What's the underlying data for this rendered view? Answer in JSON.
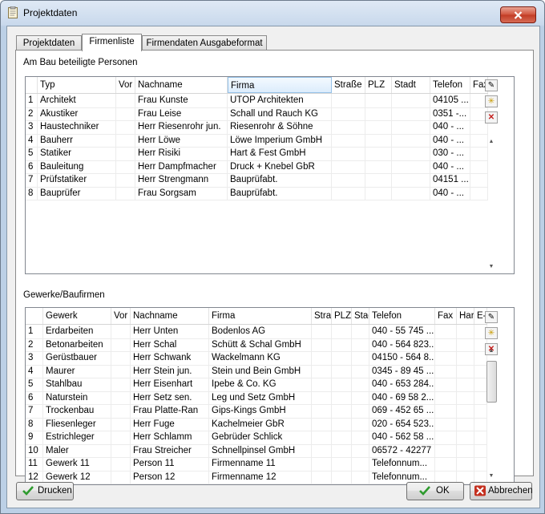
{
  "window": {
    "title": "Projektdaten"
  },
  "tabs": [
    {
      "label": "Projektdaten"
    },
    {
      "label": "Firmenliste"
    },
    {
      "label": "Firmendaten Ausgabeformat"
    }
  ],
  "persons": {
    "label": "Am Bau beteiligte Personen",
    "columns": [
      "",
      "Typ",
      "Vor",
      "Nachname",
      "Firma",
      "Straße",
      "PLZ",
      "Stadt",
      "Telefon",
      "Fax"
    ],
    "rows": [
      [
        "1",
        "Architekt",
        "",
        "Frau Kunste",
        "UTOP Architekten",
        "",
        "",
        "",
        "04105 ...",
        ""
      ],
      [
        "2",
        "Akustiker",
        "",
        "Frau Leise",
        "Schall und Rauch KG",
        "",
        "",
        "",
        "0351 -...",
        ""
      ],
      [
        "3",
        "Haustechniker",
        "",
        "Herr Riesenrohr jun.",
        "Riesenrohr & Söhne",
        "",
        "",
        "",
        "040 - ...",
        ""
      ],
      [
        "4",
        "Bauherr",
        "",
        "Herr Löwe",
        "Löwe Imperium GmbH",
        "",
        "",
        "",
        "040 - ...",
        ""
      ],
      [
        "5",
        "Statiker",
        "",
        "Herr Risiki",
        "Hart & Fest GmbH",
        "",
        "",
        "",
        "030 - ...",
        ""
      ],
      [
        "6",
        "Bauleitung",
        "",
        "Herr Dampfmacher",
        "Druck + Knebel GbR",
        "",
        "",
        "",
        "040 - ...",
        ""
      ],
      [
        "7",
        "Prüfstatiker",
        "",
        "Herr Strengmann",
        "Bauprüfabt.",
        "",
        "",
        "",
        "04151 ...",
        ""
      ],
      [
        "8",
        "Bauprüfer",
        "",
        "Frau Sorgsam",
        "Bauprüfabt.",
        "",
        "",
        "",
        "040 - ...",
        ""
      ]
    ]
  },
  "companies": {
    "label": "Gewerke/Baufirmen",
    "columns": [
      "",
      "Gewerk",
      "Vor",
      "Nachname",
      "Firma",
      "Stra",
      "PLZ",
      "Stac",
      "Telefon",
      "Fax",
      "Har",
      "E-"
    ],
    "rows": [
      [
        "1",
        "Erdarbeiten",
        "",
        "Herr Unten",
        "Bodenlos AG",
        "",
        "",
        "",
        "040 - 55 745 ...",
        "",
        "",
        ""
      ],
      [
        "2",
        "Betonarbeiten",
        "",
        "Herr Schal",
        "Schütt & Schal GmbH",
        "",
        "",
        "",
        "040 - 564 823...",
        "",
        "",
        ""
      ],
      [
        "3",
        "Gerüstbauer",
        "",
        "Herr Schwank",
        "Wackelmann KG",
        "",
        "",
        "",
        "04150 - 564 8...",
        "",
        "",
        ""
      ],
      [
        "4",
        "Maurer",
        "",
        "Herr Stein jun.",
        "Stein und Bein GmbH",
        "",
        "",
        "",
        "0345 - 89 45 ...",
        "",
        "",
        ""
      ],
      [
        "5",
        "Stahlbau",
        "",
        "Herr Eisenhart",
        "Ipebe & Co. KG",
        "",
        "",
        "",
        "040 - 653 284...",
        "",
        "",
        ""
      ],
      [
        "6",
        "Naturstein",
        "",
        "Herr Setz sen.",
        "Leg und Setz GmbH",
        "",
        "",
        "",
        "040 - 69 58 2...",
        "",
        "",
        ""
      ],
      [
        "7",
        "Trockenbau",
        "",
        "Frau Platte-Ran",
        "Gips-Kings GmbH",
        "",
        "",
        "",
        "069 - 452 65 ...",
        "",
        "",
        ""
      ],
      [
        "8",
        "Fliesenleger",
        "",
        "Herr Fuge",
        "Kachelmeier GbR",
        "",
        "",
        "",
        "020 - 654 523...",
        "",
        "",
        ""
      ],
      [
        "9",
        "Estrichleger",
        "",
        "Herr Schlamm",
        "Gebrüder Schlick",
        "",
        "",
        "",
        "040 - 562 58 ...",
        "",
        "",
        ""
      ],
      [
        "10",
        "Maler",
        "",
        "Frau Streicher",
        "Schnellpinsel GmbH",
        "",
        "",
        "",
        "06572 - 42277",
        "",
        "",
        ""
      ],
      [
        "11",
        "Gewerk 11",
        "",
        "Person 11",
        "Firmenname 11",
        "",
        "",
        "",
        "Telefonnum...",
        "",
        "",
        ""
      ],
      [
        "12",
        "Gewerk 12",
        "",
        "Person 12",
        "Firmenname 12",
        "",
        "",
        "",
        "Telefonnum...",
        "",
        "",
        ""
      ]
    ]
  },
  "buttons": {
    "print": "Drucken",
    "ok": "OK",
    "cancel": "Abbrechen"
  },
  "icons": {
    "window": "clipboard-icon",
    "close": "close-icon",
    "check": "checkmark-icon",
    "cancel": "red-x-icon"
  }
}
